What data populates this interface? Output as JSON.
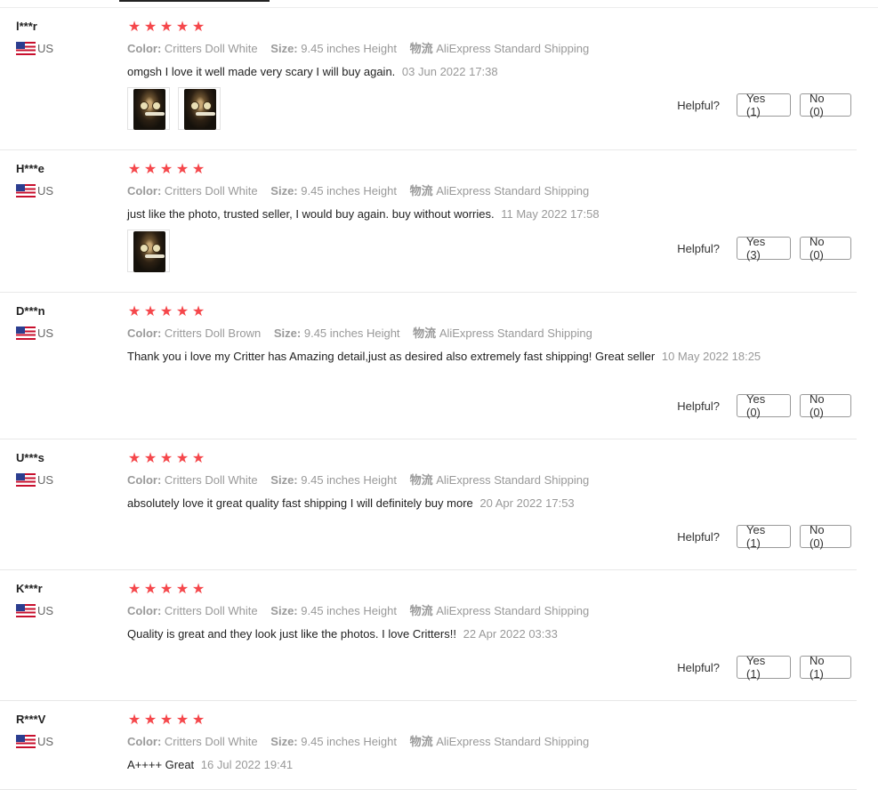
{
  "labels": {
    "color": "Color:",
    "size": "Size:",
    "shipping": "物流",
    "helpful": "Helpful?"
  },
  "colors": {
    "star": "#f5474b",
    "divider": "#e8e8e8"
  },
  "icons": {
    "star": "★",
    "flag": "us-flag-icon"
  },
  "reviews": [
    {
      "user": "l***r",
      "country": "US",
      "rating": 5,
      "color": "Critters Doll White",
      "size": "9.45 inches Height",
      "shipping": "AliExpress Standard Shipping",
      "text": "omgsh I love it well made very scary I will buy again.",
      "date": "03 Jun 2022 17:38",
      "photos": 2,
      "yes": "Yes (1)",
      "no": "No (0)"
    },
    {
      "user": "H***e",
      "country": "US",
      "rating": 5,
      "color": "Critters Doll White",
      "size": "9.45 inches Height",
      "shipping": "AliExpress Standard Shipping",
      "text": "just like the photo, trusted seller, I would buy again. buy without worries.",
      "date": "11 May 2022 17:58",
      "photos": 1,
      "yes": "Yes (3)",
      "no": "No (0)"
    },
    {
      "user": "D***n",
      "country": "US",
      "rating": 5,
      "color": "Critters Doll Brown",
      "size": "9.45 inches Height",
      "shipping": "AliExpress Standard Shipping",
      "text": "Thank you i love my Critter has Amazing detail,just as desired also extremely fast shipping! Great seller",
      "date": "10 May 2022 18:25",
      "photos": 0,
      "yes": "Yes (0)",
      "no": "No (0)"
    },
    {
      "user": "U***s",
      "country": "US",
      "rating": 5,
      "color": "Critters Doll White",
      "size": "9.45 inches Height",
      "shipping": "AliExpress Standard Shipping",
      "text": "absolutely love it great quality fast shipping I will definitely buy more",
      "date": "20 Apr 2022 17:53",
      "photos": 0,
      "yes": "Yes (1)",
      "no": "No (0)"
    },
    {
      "user": "K***r",
      "country": "US",
      "rating": 5,
      "color": "Critters Doll White",
      "size": "9.45 inches Height",
      "shipping": "AliExpress Standard Shipping",
      "text": "Quality is great and they look just like the photos. I love Critters!!",
      "date": "22 Apr 2022 03:33",
      "photos": 0,
      "yes": "Yes (1)",
      "no": "No (1)"
    },
    {
      "user": "R***V",
      "country": "US",
      "rating": 5,
      "color": "Critters Doll White",
      "size": "9.45 inches Height",
      "shipping": "AliExpress Standard Shipping",
      "text": "A++++ Great",
      "date": "16 Jul 2022 19:41",
      "photos": 0,
      "yes": "",
      "no": ""
    }
  ]
}
